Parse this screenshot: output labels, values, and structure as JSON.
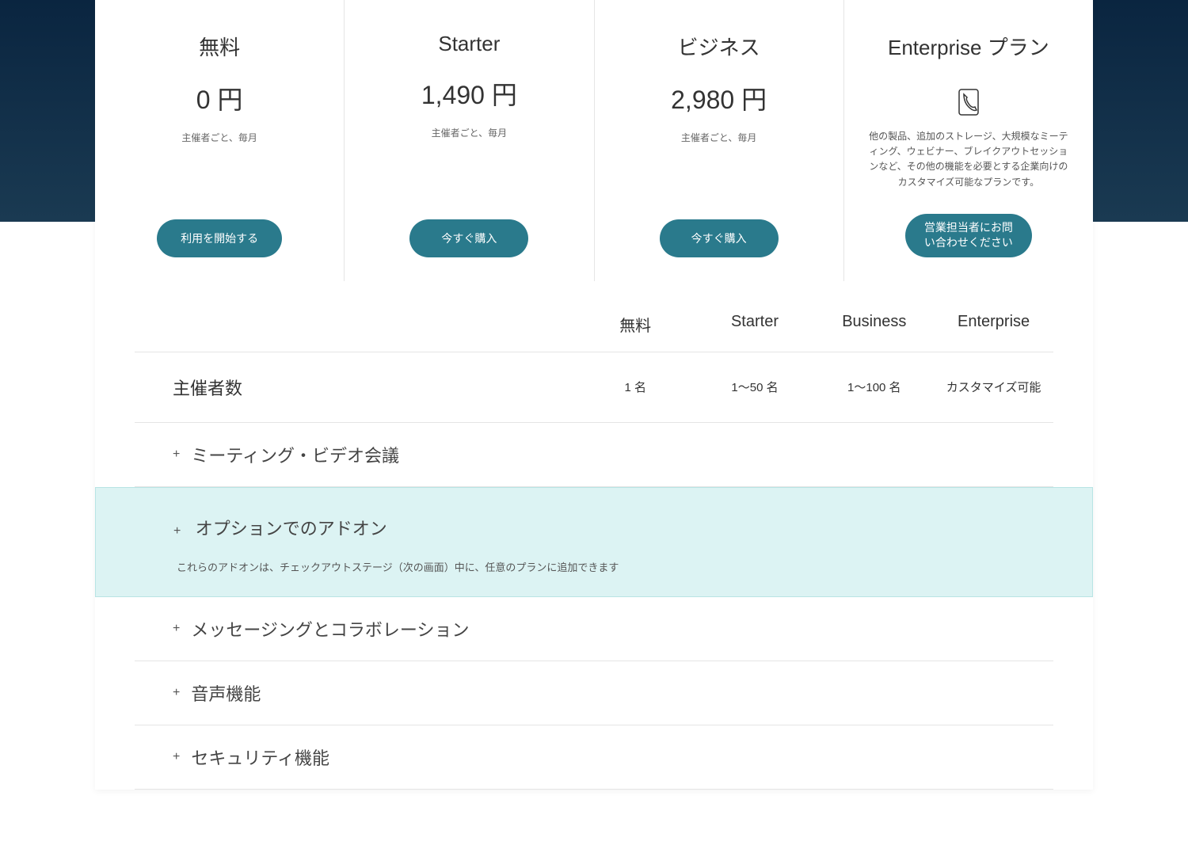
{
  "plans": [
    {
      "title": "無料",
      "price": "0 円",
      "note": "主催者ごと、毎月",
      "cta": "利用を開始する"
    },
    {
      "title": "Starter",
      "price": "1,490 円",
      "note": "主催者ごと、毎月",
      "cta": "今すぐ購入"
    },
    {
      "title": "ビジネス",
      "price": "2,980 円",
      "note": "主催者ごと、毎月",
      "cta": "今すぐ購入"
    },
    {
      "title": "Enterprise プラン",
      "desc": "他の製品、追加のストレージ、大規模なミーティング、ウェビナー、ブレイクアウトセッションなど、その他の機能を必要とする企業向けのカスタマイズ可能なプランです。",
      "cta": "営業担当者にお問\nい合わせください"
    }
  ],
  "compare": {
    "headers": [
      "無料",
      "Starter",
      "Business",
      "Enterprise"
    ],
    "row": {
      "label": "主催者数",
      "values": [
        "1 名",
        "1～50 名",
        "1～100 名",
        "カスタマイズ可能"
      ]
    }
  },
  "accordions": [
    {
      "title": "ミーティング・ビデオ会議"
    },
    {
      "title": "オプションでのアドオン",
      "subtitle": "これらのアドオンは、チェックアウトステージ（次の画面）中に、任意のプランに追加できます",
      "highlighted": true
    },
    {
      "title": "メッセージングとコラボレーション"
    },
    {
      "title": "音声機能"
    },
    {
      "title": "セキュリティ機能"
    }
  ],
  "plus": "+"
}
